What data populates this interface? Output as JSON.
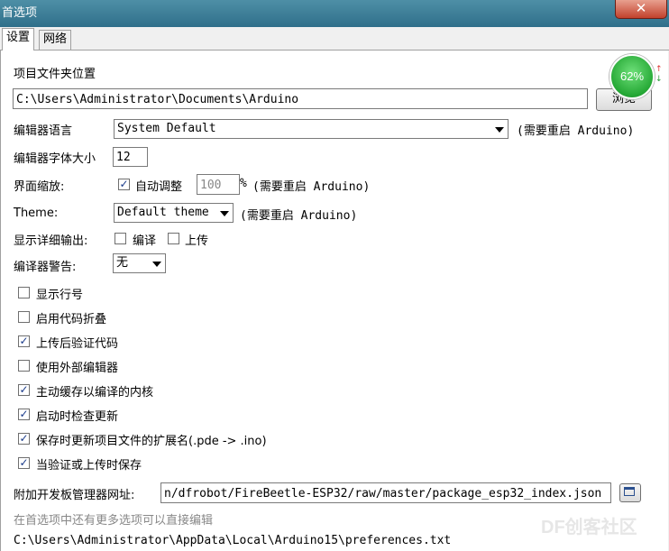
{
  "window": {
    "title": "首选项",
    "close_glyph": "✕"
  },
  "tabs": [
    {
      "label": "设置",
      "active": true
    },
    {
      "label": "网络",
      "active": false
    }
  ],
  "sketchbook": {
    "label": "项目文件夹位置",
    "path": "C:\\Users\\Administrator\\Documents\\Arduino",
    "browse_label": "浏览"
  },
  "editor_language": {
    "label": "编辑器语言",
    "value": "System Default",
    "note": "(需要重启 Arduino)"
  },
  "editor_font_size": {
    "label": "编辑器字体大小",
    "value": "12"
  },
  "interface_scale": {
    "label": "界面缩放:",
    "auto_label": "自动调整",
    "auto_checked": true,
    "value": "100",
    "unit": "%",
    "note": "(需要重启 Arduino)"
  },
  "theme": {
    "label": "Theme:",
    "value": "Default theme",
    "note": "(需要重启 Arduino)"
  },
  "verbose": {
    "label": "显示详细输出:",
    "compile_label": "编译",
    "compile_checked": false,
    "upload_label": "上传",
    "upload_checked": false
  },
  "compiler_warnings": {
    "label": "编译器警告:",
    "value": "无"
  },
  "options": [
    {
      "label": "显示行号",
      "checked": false
    },
    {
      "label": "启用代码折叠",
      "checked": false
    },
    {
      "label": "上传后验证代码",
      "checked": true
    },
    {
      "label": "使用外部编辑器",
      "checked": false
    },
    {
      "label": "主动缓存以编译的内核",
      "checked": true
    },
    {
      "label": "启动时检查更新",
      "checked": true
    },
    {
      "label": "保存时更新项目文件的扩展名(.pde -> .ino)",
      "checked": true
    },
    {
      "label": "当验证或上传时保存",
      "checked": true
    }
  ],
  "board_urls": {
    "label": "附加开发板管理器网址:",
    "value": "n/dfrobot/FireBeetle-ESP32/raw/master/package_esp32_index.json"
  },
  "more_prefs_note": "在首选项中还有更多选项可以直接编辑",
  "prefs_path": "C:\\Users\\Administrator\\AppData\\Local\\Arduino15\\preferences.txt",
  "overlay": {
    "percent": "62%",
    "up": "↑",
    "down": "↓"
  },
  "watermark": "DF创客社区",
  "colors": {
    "title_bar": "#3a7f98",
    "close_button": "#c2412c",
    "check": "#1a3b8a"
  }
}
